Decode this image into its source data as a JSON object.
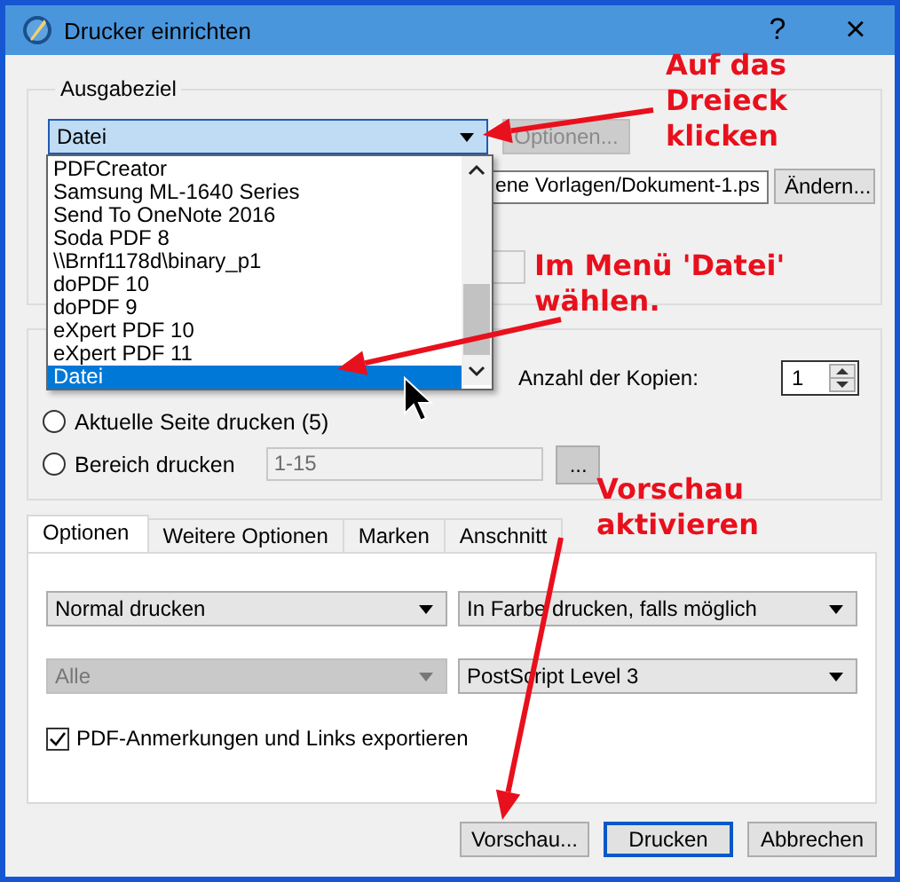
{
  "window": {
    "title": "Drucker einrichten",
    "help": "?",
    "close": "×"
  },
  "output_group": {
    "label": "Ausgabeziel",
    "destination": "Datei",
    "options_button": {
      "label": "Optionen...",
      "disabled": true
    },
    "file_path": "ene Vorlagen/Dokument-1.ps",
    "change_button": "Ändern..."
  },
  "dropdown_list": {
    "items": [
      {
        "label": "PDFCreator",
        "selected": false
      },
      {
        "label": "Samsung ML-1640 Series",
        "selected": false
      },
      {
        "label": "Send To OneNote 2016",
        "selected": false
      },
      {
        "label": "Soda PDF 8",
        "selected": false
      },
      {
        "label": "\\\\Brnf1178d\\binary_p1",
        "selected": false
      },
      {
        "label": "doPDF 10",
        "selected": false
      },
      {
        "label": "doPDF 9",
        "selected": false
      },
      {
        "label": "eXpert PDF 10",
        "selected": false
      },
      {
        "label": "eXpert PDF 11",
        "selected": false
      },
      {
        "label": "Datei",
        "selected": true
      }
    ]
  },
  "range_group": {
    "copies_label": "Anzahl der Kopien:",
    "copies": "1",
    "radios": [
      {
        "label": "Aktuelle Seite drucken (5)",
        "selected": false
      },
      {
        "label": "Bereich drucken",
        "selected": false
      }
    ],
    "range_field": {
      "value": "1-15",
      "disabled": true
    },
    "range_button": "..."
  },
  "tabs": [
    {
      "label": "Optionen",
      "selected": true
    },
    {
      "label": "Weitere Optionen",
      "selected": false
    },
    {
      "label": "Marken",
      "selected": false
    },
    {
      "label": "Anschnitt",
      "selected": false
    }
  ],
  "options": {
    "selects": [
      {
        "value": "Normal drucken",
        "disabled": false
      },
      {
        "value": "In Farbe drucken, falls möglich",
        "disabled": false
      },
      {
        "value": "Alle",
        "disabled": true
      },
      {
        "value": "PostScript Level 3",
        "disabled": false
      }
    ],
    "checkbox": {
      "label": "PDF-Anmerkungen und Links exportieren",
      "checked": true
    }
  },
  "buttons": [
    {
      "label": "Vorschau...",
      "default": false
    },
    {
      "label": "Drucken",
      "default": true
    },
    {
      "label": "Abbrechen",
      "default": false
    }
  ],
  "annotations": [
    {
      "lines": [
        "Auf das",
        "Dreieck",
        "klicken"
      ]
    },
    {
      "lines": [
        "Im Menü 'Datei'",
        "wählen."
      ]
    },
    {
      "lines": [
        "Vorschau",
        "aktivieren"
      ]
    }
  ]
}
